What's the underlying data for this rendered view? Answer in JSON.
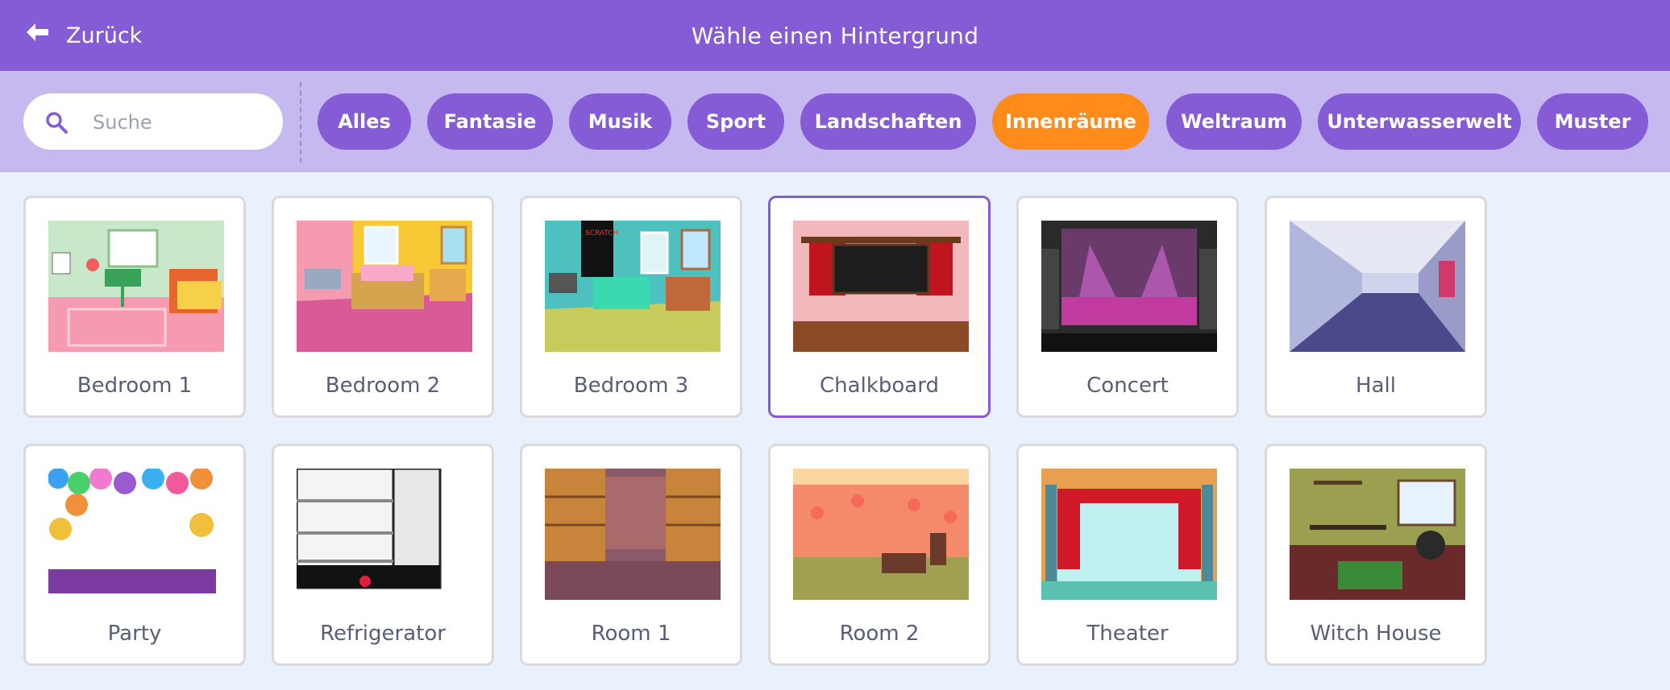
{
  "header": {
    "back_label": "Zurück",
    "title": "Wähle einen Hintergrund"
  },
  "search": {
    "placeholder": "Suche",
    "value": ""
  },
  "tags": [
    {
      "label": "Alles"
    },
    {
      "label": "Fantasie"
    },
    {
      "label": "Musik"
    },
    {
      "label": "Sport"
    },
    {
      "label": "Landschaften"
    },
    {
      "label": "Innenräume",
      "active": true
    },
    {
      "label": "Weltraum"
    },
    {
      "label": "Unterwasserwelt"
    },
    {
      "label": "Muster"
    }
  ],
  "backdrops": [
    {
      "name": "Bedroom 1"
    },
    {
      "name": "Bedroom 2"
    },
    {
      "name": "Bedroom 3"
    },
    {
      "name": "Chalkboard",
      "selected": true
    },
    {
      "name": "Concert"
    },
    {
      "name": "Hall"
    },
    {
      "name": "Party"
    },
    {
      "name": "Refrigerator"
    },
    {
      "name": "Room 1"
    },
    {
      "name": "Room 2"
    },
    {
      "name": "Theater"
    },
    {
      "name": "Witch House"
    }
  ],
  "colors": {
    "header": "#855cd6",
    "filter_bar": "#c6b9f0",
    "tag": "#855cd6",
    "tag_active": "#ff8c1a",
    "background": "#e9f1fc"
  }
}
